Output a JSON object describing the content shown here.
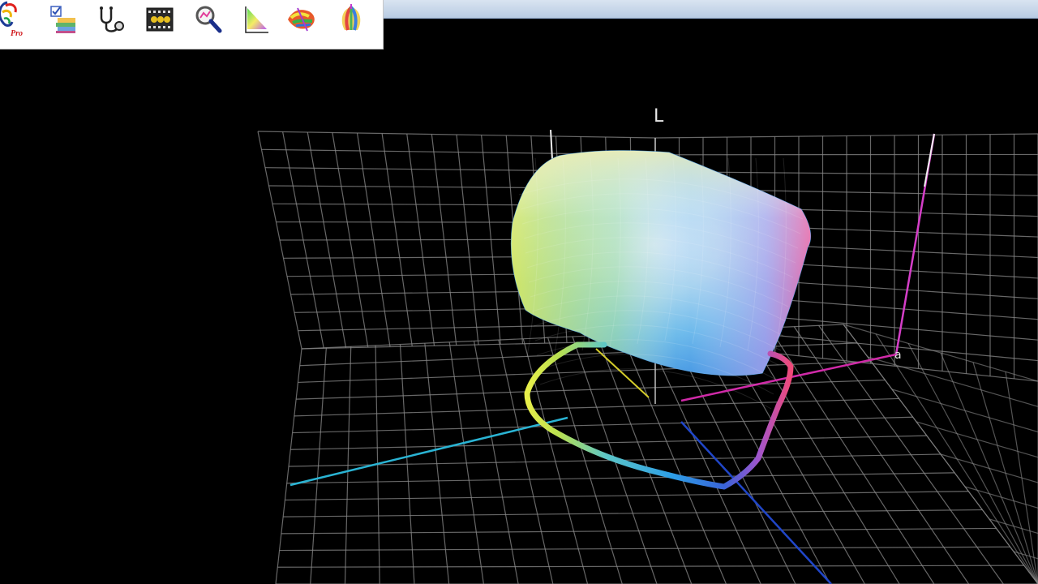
{
  "window": {
    "accent": "#c6d6ea"
  },
  "toolbar": {
    "tools": [
      {
        "icon": "app-logo-pro-icon",
        "badge": "Pro"
      },
      {
        "icon": "checklist-pages-icon"
      },
      {
        "icon": "stethoscope-icon"
      },
      {
        "icon": "film-strip-icon"
      },
      {
        "icon": "magnifier-icon"
      },
      {
        "icon": "color-triangle-gamut-icon"
      },
      {
        "icon": "color-spectrum-icon"
      },
      {
        "icon": "colorful-balloon-icon"
      }
    ]
  },
  "scene": {
    "axes": {
      "l_label": "L",
      "a_label": "a"
    },
    "grid_color": "#8a8a8a",
    "background": "#000000"
  }
}
